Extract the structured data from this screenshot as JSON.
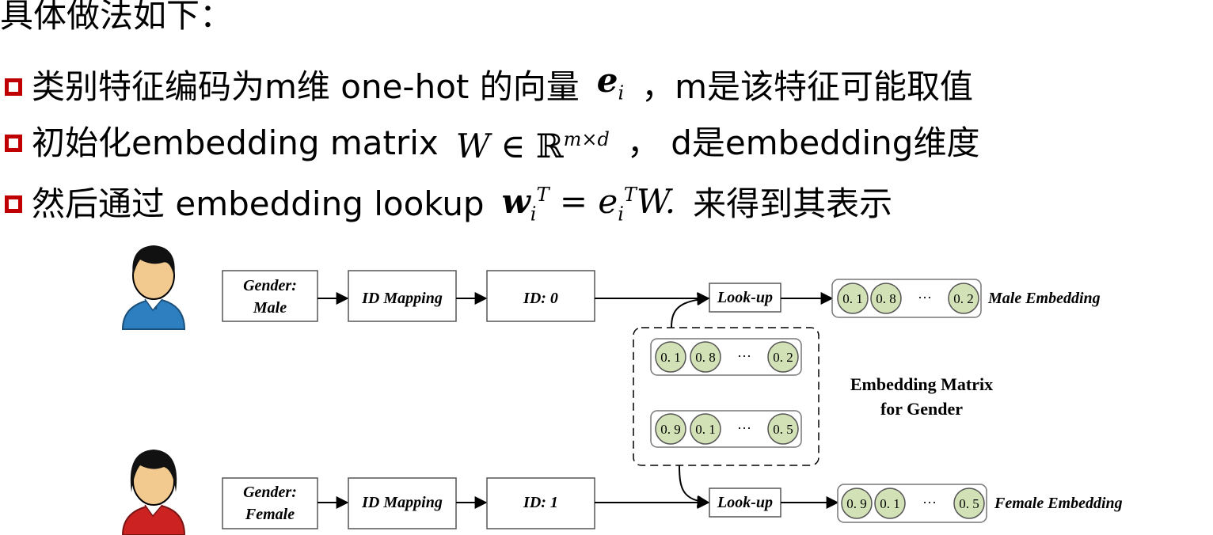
{
  "heading": "具体做法如下：",
  "bullets": [
    {
      "pre": "类别特征编码为m维 one-hot 的向量",
      "math": "e",
      "math_sub": "i",
      "post": "，m是该特征可能取值"
    },
    {
      "pre": "初始化embedding matrix",
      "math": "W ∈ ",
      "math_set": "ℝ",
      "math_sup": "m×d",
      "post": "，  d是embedding维度"
    },
    {
      "pre": "然后通过 embedding lookup",
      "math": "w",
      "math_sub": "i",
      "math_sup": "T",
      "math_rest": " = e",
      "math_sub2": "i",
      "math_sup2": "T",
      "math_tail": "W.",
      "post": "来得到其表示"
    }
  ],
  "diagram": {
    "male": {
      "gender_line1": "Gender:",
      "gender_line2": "Male",
      "mapping": "ID Mapping",
      "id": "ID: 0",
      "lookup": "Look-up",
      "embedding": [
        "0. 1",
        "0. 8",
        "···",
        "0. 2"
      ],
      "embedding_label": "Male Embedding"
    },
    "female": {
      "gender_line1": "Gender:",
      "gender_line2": "Female",
      "mapping": "ID Mapping",
      "id": "ID: 1",
      "lookup": "Look-up",
      "embedding": [
        "0. 9",
        "0. 1",
        "···",
        "0. 5"
      ],
      "embedding_label": "Female Embedding"
    },
    "matrix": {
      "row1": [
        "0. 1",
        "0. 8",
        "···",
        "0. 2"
      ],
      "row2": [
        "0. 9",
        "0. 1",
        "···",
        "0. 5"
      ],
      "label_line1": "Embedding Matrix",
      "label_line2": "for Gender"
    },
    "colors": {
      "circle_fill": "#d3e2b6",
      "male_shirt": "#2e7fc0",
      "female_shirt": "#cc2222",
      "bullet": "#c00000"
    },
    "icons": [
      "male-user-icon",
      "female-user-icon"
    ]
  }
}
